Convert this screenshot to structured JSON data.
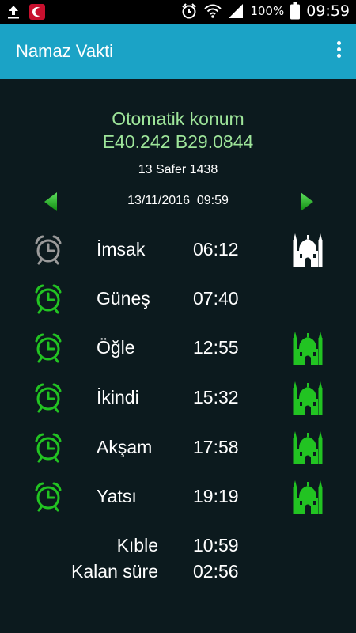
{
  "status_bar": {
    "battery": "100%",
    "time": "09:59",
    "icons": [
      "upload-icon",
      "app-crescent-icon",
      "alarm-icon",
      "wifi-icon",
      "signal-icon",
      "battery-icon"
    ]
  },
  "app_bar": {
    "title": "Namaz Vakti",
    "menu_icon": "overflow-menu-icon"
  },
  "location": {
    "line1": "Otomatik konum",
    "line2": "E40.242 B29.0844",
    "color": "#9ee59a"
  },
  "hijri_date": "13 Safer 1438",
  "datetime": "13/11/2016  09:59",
  "prayers": [
    {
      "name": "İmsak",
      "time": "06:12",
      "alarm_color": "#9a9a9a",
      "mosque": "white"
    },
    {
      "name": "Güneş",
      "time": "07:40",
      "alarm_color": "#22c322",
      "mosque": "none"
    },
    {
      "name": "Öğle",
      "time": "12:55",
      "alarm_color": "#22c322",
      "mosque": "green"
    },
    {
      "name": "İkindi",
      "time": "15:32",
      "alarm_color": "#22c322",
      "mosque": "green"
    },
    {
      "name": "Akşam",
      "time": "17:58",
      "alarm_color": "#22c322",
      "mosque": "green"
    },
    {
      "name": "Yatsı",
      "time": "19:19",
      "alarm_color": "#22c322",
      "mosque": "green"
    }
  ],
  "qibla": {
    "label": "Kıble",
    "value": "10:59"
  },
  "remaining": {
    "label": "Kalan süre",
    "value": "02:56"
  },
  "colors": {
    "app_bar": "#1ba3c6",
    "background": "#0c1a1e",
    "accent_green": "#22c322"
  }
}
